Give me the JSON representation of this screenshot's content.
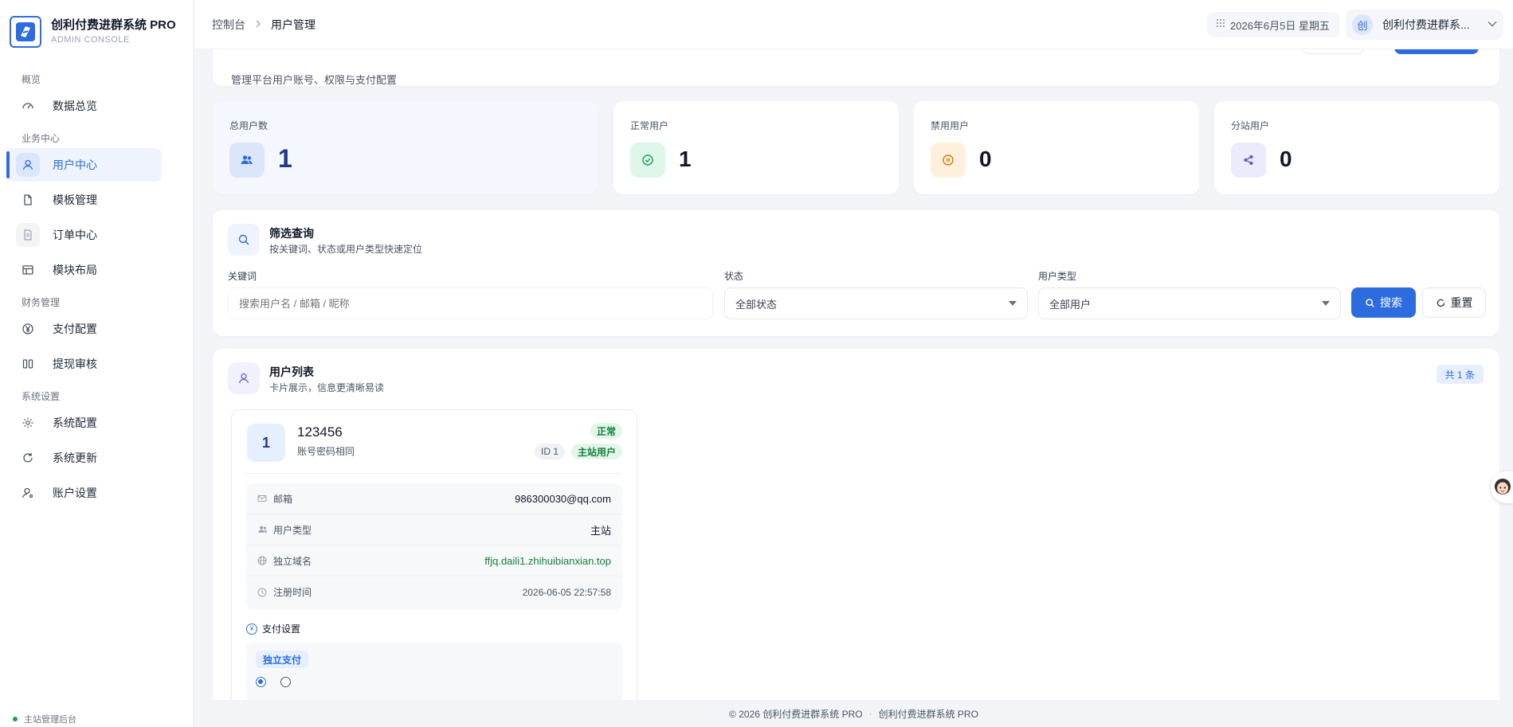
{
  "brand": {
    "title": "创利付费进群系统 PRO",
    "subtitle": "ADMIN CONSOLE"
  },
  "sidebar": {
    "groups": [
      {
        "label": "概览",
        "items": [
          {
            "label": "数据总览",
            "icon": "dashboard-gauge-icon"
          }
        ]
      },
      {
        "label": "业务中心",
        "items": [
          {
            "label": "用户中心",
            "icon": "user-icon",
            "active": true
          },
          {
            "label": "模板管理",
            "icon": "file-icon"
          },
          {
            "label": "订单中心",
            "icon": "order-doc-icon",
            "disabled": true
          },
          {
            "label": "模块布局",
            "icon": "layout-icon"
          }
        ]
      },
      {
        "label": "财务管理",
        "items": [
          {
            "label": "支付配置",
            "icon": "yen-icon"
          },
          {
            "label": "提现审核",
            "icon": "withdraw-icon"
          }
        ]
      },
      {
        "label": "系统设置",
        "items": [
          {
            "label": "系统配置",
            "icon": "gear-icon"
          },
          {
            "label": "系统更新",
            "icon": "refresh-icon"
          },
          {
            "label": "账户设置",
            "icon": "account-icon"
          }
        ]
      }
    ],
    "footer": "主站管理后台"
  },
  "topbar": {
    "breadcrumb": [
      "控制台",
      "用户管理"
    ],
    "date": "2026年6月5日 星期五",
    "user_avatar": "创",
    "user_name": "创利付费进群系..."
  },
  "page_header": {
    "description": "管理平台用户账号、权限与支付配置"
  },
  "stats": [
    {
      "label": "总用户数",
      "value": "1",
      "icon": "users-icon"
    },
    {
      "label": "正常用户",
      "value": "1",
      "icon": "check-circle-icon"
    },
    {
      "label": "禁用用户",
      "value": "0",
      "icon": "pause-circle-icon"
    },
    {
      "label": "分站用户",
      "value": "0",
      "icon": "share-icon"
    }
  ],
  "filter": {
    "title": "筛选查询",
    "subtitle": "按关键词、状态或用户类型快速定位",
    "keyword_label": "关键词",
    "keyword_placeholder": "搜索用户名 / 邮箱 / 昵称",
    "status_label": "状态",
    "status_value": "全部状态",
    "type_label": "用户类型",
    "type_value": "全部用户",
    "search_button": "搜索",
    "reset_button": "重置"
  },
  "list": {
    "title": "用户列表",
    "subtitle": "卡片展示，信息更清晰易读",
    "count": "共 1 条",
    "users": [
      {
        "avatar": "1",
        "username": "123456",
        "note": "账号密码相同",
        "status": "正常",
        "id_badge": "ID 1",
        "role_badge": "主站用户",
        "rows": [
          {
            "label": "邮箱",
            "value": "986300030@qq.com",
            "icon": "mail-icon"
          },
          {
            "label": "用户类型",
            "value": "主站",
            "icon": "users-icon"
          },
          {
            "label": "独立域名",
            "value": "ffjq.daili1.zhihuibianxian.top",
            "icon": "globe-icon"
          },
          {
            "label": "注册时间",
            "value": "2026-06-05 22:57:58",
            "icon": "clock-icon"
          }
        ],
        "pay_title": "支付设置",
        "pay_tag": "独立支付"
      }
    ]
  },
  "footer": {
    "copyright": "© 2026 创利付费进群系统 PRO",
    "product": "创利付费进群系统 PRO"
  },
  "colors": {
    "primary": "#2d6cdf",
    "success": "#16a34a",
    "warning": "#d97706",
    "purple": "#6d5bd0"
  }
}
